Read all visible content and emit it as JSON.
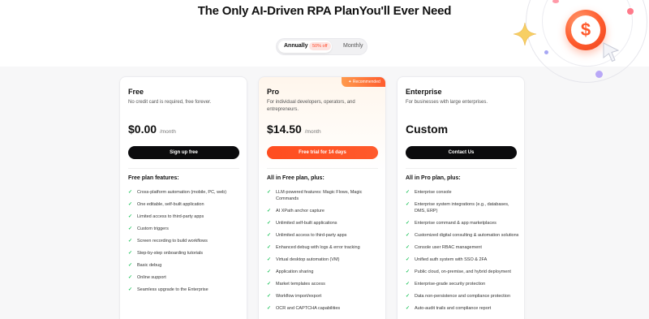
{
  "headline": "The Only AI-Driven RPA PlanYou'll Ever Need",
  "toggle": {
    "annually": "Annually",
    "discount": "50% off",
    "monthly": "Monthly"
  },
  "plans": [
    {
      "name": "Free",
      "desc": "No credit card is required, free forever.",
      "price": "$0.00",
      "per": "/month",
      "cta": "Sign up free",
      "features_title": "Free plan features:",
      "features": [
        "Cross-platform automation (mobile, PC, web)",
        "One editable, self-built application",
        "Limited access to third-party apps",
        "Custom triggers",
        "Screen recording to build workflows",
        "Step-by-step onboarding tutorials",
        "Basic debug",
        "Online support",
        "Seamless upgrade to the Enterprise"
      ]
    },
    {
      "name": "Pro",
      "ribbon": "Recommended",
      "desc": "For individual developers, operators, and entrepreneurs.",
      "price": "$14.50",
      "per": "/month",
      "cta": "Free trial for 14 days",
      "features_title": "All in Free plan, plus:",
      "features": [
        "LLM-powered features: Magic Flows, Magic Commands",
        "AI XPath anchor capture",
        "Unlimited self-built applications",
        "Unlimited access to third-party apps",
        "Enhanced debug with logs & error tracking",
        "Virtual desktop automation (VM)",
        "Application sharing",
        "Market templates access",
        "Workflow import/export",
        "OCR and CAPTCHA capabilities"
      ]
    },
    {
      "name": "Enterprise",
      "desc": "For businesses with large enterprises.",
      "price": "Custom",
      "per": "",
      "cta": "Contact Us",
      "features_title": "All in Pro plan, plus:",
      "features": [
        "Enterprise console",
        "Enterprise system integrations (e.g., databases, DMS, ERP)",
        "Enterprise command & app marketplaces",
        "Customized digital consulting & automation solutions",
        "Console user RBAC management",
        "Unified auth system with SSO & 2FA",
        "Public cloud, on-premise, and hybrid deployment",
        "Enterprise-grade security protection",
        "Data non-persistence and compliance protection",
        "Auto-audit trails and compliance report"
      ]
    }
  ],
  "colors": {
    "accent": "#ff5a2c",
    "check": "#22c55e",
    "dark_button": "#0b0b0d"
  },
  "icons": {
    "coin": "dollar-coin-icon",
    "sparkle": "sparkle-icon",
    "cursor": "cursor-icon",
    "check": "check-icon"
  }
}
